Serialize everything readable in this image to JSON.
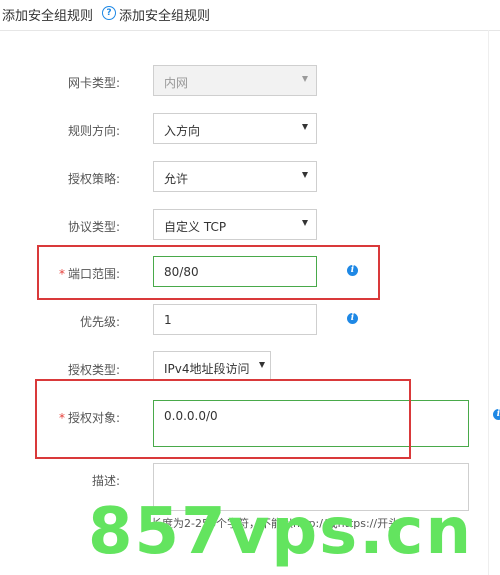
{
  "header": {
    "title": "添加安全组规则",
    "help_text": "添加安全组规则",
    "help_icon": "question-circle-icon"
  },
  "form": {
    "nic_type": {
      "label": "网卡类型:",
      "value": "内网",
      "disabled": true
    },
    "direction": {
      "label": "规则方向:",
      "value": "入方向"
    },
    "policy": {
      "label": "授权策略:",
      "value": "允许"
    },
    "protocol": {
      "label": "协议类型:",
      "value": "自定义 TCP"
    },
    "port_range": {
      "label": "端口范围:",
      "required_mark": "*",
      "value": "80/80"
    },
    "priority": {
      "label": "优先级:",
      "value": "1"
    },
    "auth_type": {
      "label": "授权类型:",
      "value": "IPv4地址段访问"
    },
    "auth_object": {
      "label": "授权对象:",
      "required_mark": "*",
      "value": "0.0.0.0/0"
    },
    "description": {
      "label": "描述:",
      "value": "",
      "hint": "长度为2-256个字符，不能以http://或https://开头。"
    }
  },
  "icons": {
    "info": "info-icon",
    "dropdown": "caret-down-icon"
  },
  "watermark": "857vps.cn",
  "colors": {
    "accent_blue": "#1e88e5",
    "highlight_red": "#d9393a",
    "valid_green": "#49a94a",
    "watermark_green": "#63e45f"
  }
}
